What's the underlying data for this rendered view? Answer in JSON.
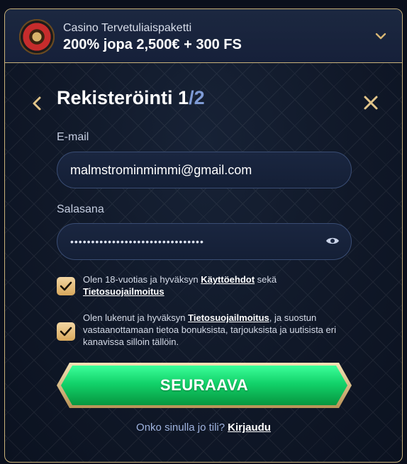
{
  "bonus": {
    "title": "Casino Tervetuliaispaketti",
    "offer": "200% jopa 2,500€ + 300 FS"
  },
  "form": {
    "heading": "Rekisteröinti 1",
    "step": "/2",
    "email_label": "E-mail",
    "email_value": "malmstrominmimmi@gmail.com",
    "password_label": "Salasana",
    "password_mask": "••••••••••••••••••••••••••••••••",
    "terms_prefix": "Olen 18-vuotias ja hyväksyn ",
    "terms_link": "Käyttöehdot",
    "terms_mid": " sekä ",
    "privacy_link": "Tietosuojailmoitus",
    "marketing_prefix": "Olen lukenut ja hyväksyn ",
    "marketing_link": "Tietosuojailmoitus",
    "marketing_suffix": ", ja suostun vastaanottamaan tietoa bonuksista, tarjouksista ja uutisista eri kanavissa silloin tällöin.",
    "submit_label": "SEURAAVA",
    "login_prompt": "Onko sinulla jo tili?",
    "login_link": "Kirjaudu"
  },
  "colors": {
    "accent_gold": "#c9b27a",
    "button_green": "#12d26a",
    "background": "#101828"
  },
  "icons": [
    "roulette-logo-icon",
    "chevron-down-icon",
    "back-arrow-icon",
    "close-icon",
    "eye-icon",
    "checkmark-icon"
  ]
}
